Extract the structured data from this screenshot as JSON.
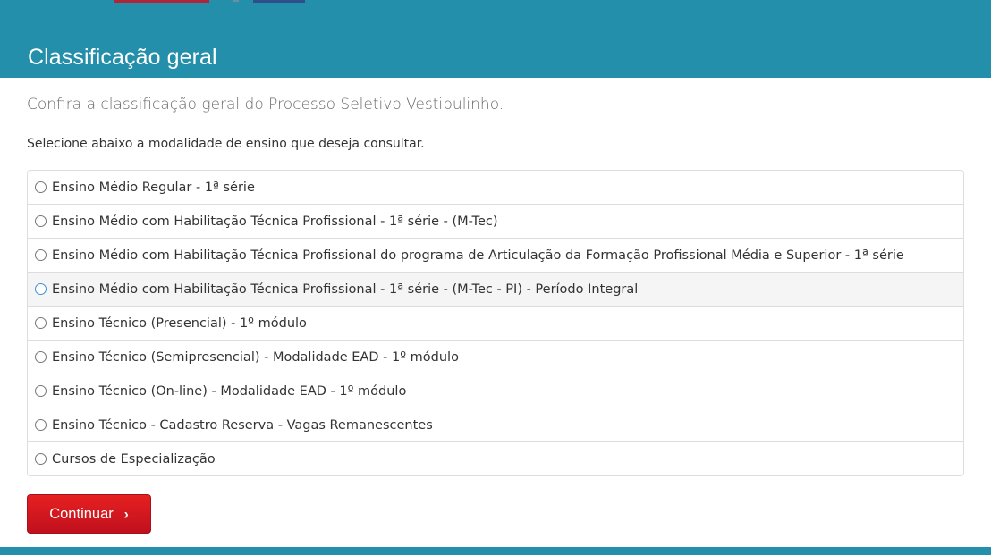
{
  "header": {
    "title": "Classificação geral",
    "bar_color": "#238fab"
  },
  "main": {
    "intro": "Confira a classificação geral do Processo Seletivo Vestibulinho.",
    "instruction": "Selecione abaixo a modalidade de ensino que deseja consultar.",
    "options": [
      {
        "label": "Ensino Médio Regular - 1ª série",
        "selected": false
      },
      {
        "label": "Ensino Médio com Habilitação Técnica Profissional - 1ª série - (M-Tec)",
        "selected": false
      },
      {
        "label": "Ensino Médio com Habilitação Técnica Profissional do programa de Articulação da Formação Profissional Média e Superior - 1ª série",
        "selected": false
      },
      {
        "label": "Ensino Médio com Habilitação Técnica Profissional - 1ª série - (M-Tec - PI) - Período Integral",
        "selected": false
      },
      {
        "label": "Ensino Técnico (Presencial) - 1º módulo",
        "selected": false
      },
      {
        "label": "Ensino Técnico (Semipresencial) - Modalidade EAD - 1º módulo",
        "selected": false
      },
      {
        "label": "Ensino Técnico (On-line) - Modalidade EAD - 1º módulo",
        "selected": false
      },
      {
        "label": "Ensino Técnico - Cadastro Reserva - Vagas Remanescentes",
        "selected": false
      },
      {
        "label": "Cursos de Especialização",
        "selected": false
      }
    ],
    "continue_label": "Continuar",
    "continue_icon": "chevron-right-icon",
    "button_color": "#d7141f"
  }
}
